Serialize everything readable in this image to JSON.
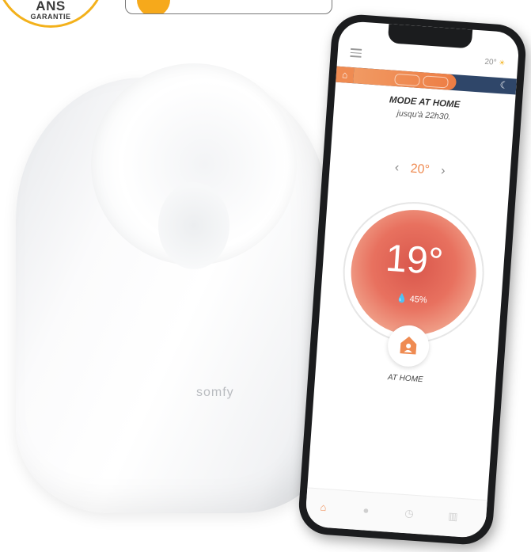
{
  "badge": {
    "line1": "ANS",
    "line2": "GARANTIE"
  },
  "device": {
    "logo": "somfy"
  },
  "phone": {
    "status_temp": "20°",
    "mode_title": "MODE AT HOME",
    "mode_subtitle": "jusqu'à 22h30.",
    "setpoint": "20°",
    "current_temp": "19°",
    "humidity": "45%",
    "home_label": "AT HOME"
  },
  "colors": {
    "accent": "#ef8b52",
    "badge": "#f3b11b",
    "schedule_night": "#2f4669",
    "dial": "#e8715f"
  },
  "icons": [
    "menu-icon",
    "sun-icon",
    "moon-icon",
    "home-icon",
    "drop-icon",
    "chevron-left-icon",
    "chevron-right-icon",
    "clock-icon",
    "chart-icon"
  ]
}
